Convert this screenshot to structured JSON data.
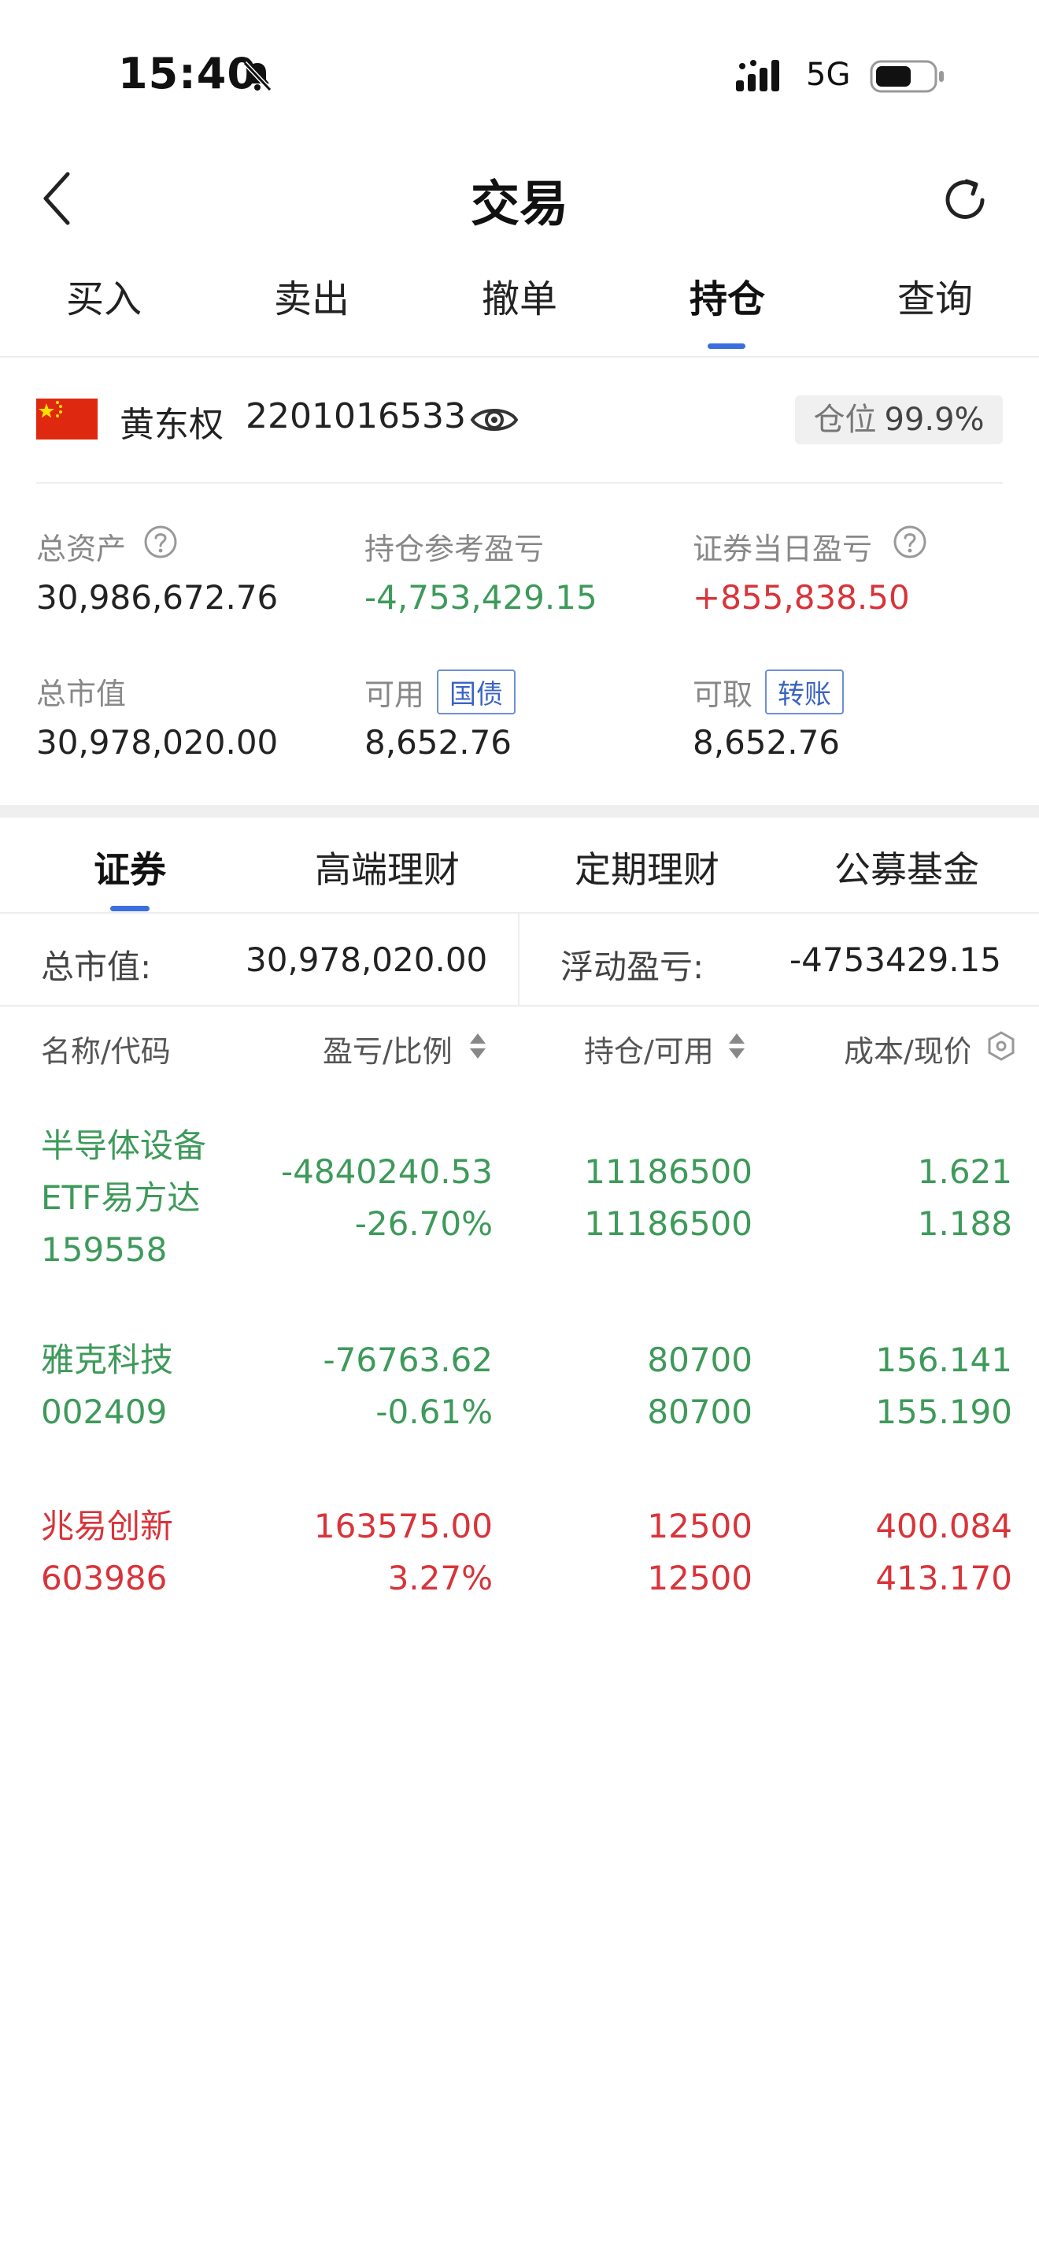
{
  "status_bar": {
    "time": "15:40",
    "network": "5G"
  },
  "nav": {
    "title": "交易"
  },
  "tabs": [
    "买入",
    "卖出",
    "撤单",
    "持仓",
    "查询"
  ],
  "account": {
    "name": "黄东权",
    "id": "2201016533",
    "position_label": "仓位",
    "position_value": "99.9%"
  },
  "metrics": {
    "total_assets_label": "总资产",
    "total_assets": "30,986,672.76",
    "holding_pnl_label": "持仓参考盈亏",
    "holding_pnl": "-4,753,429.15",
    "daily_pnl_label": "证券当日盈亏",
    "daily_pnl": "+855,838.50",
    "market_value_label": "总市值",
    "market_value": "30,978,020.00",
    "available_label": "可用",
    "available_tag": "国债",
    "available": "8,652.76",
    "withdrawable_label": "可取",
    "withdrawable_tag": "转账",
    "withdrawable": "8,652.76"
  },
  "subtabs": [
    "证券",
    "高端理财",
    "定期理财",
    "公募基金"
  ],
  "summary": {
    "market_value_label": "总市值:",
    "market_value": "30,978,020.00",
    "float_pnl_label": "浮动盈亏:",
    "float_pnl": "-4753429.15"
  },
  "table": {
    "headers": [
      "名称/代码",
      "盈亏/比例",
      "持仓/可用",
      "成本/现价"
    ],
    "rows": [
      {
        "name1": "半导体设备",
        "name2": "ETF易方达",
        "code": "159558",
        "pnl": "-4840240.53",
        "ratio": "-26.70%",
        "holding": "11186500",
        "available": "11186500",
        "cost": "1.621",
        "price": "1.188",
        "color": "#3e9a5a"
      },
      {
        "name1": "雅克科技",
        "code": "002409",
        "pnl": "-76763.62",
        "ratio": "-0.61%",
        "holding": "80700",
        "available": "80700",
        "cost": "156.141",
        "price": "155.190",
        "color": "#3e9a5a"
      },
      {
        "name1": "兆易创新",
        "code": "603986",
        "pnl": "163575.00",
        "ratio": "3.27%",
        "holding": "12500",
        "available": "12500",
        "cost": "400.084",
        "price": "413.170",
        "color": "#d8343a"
      }
    ]
  },
  "icons": {
    "back": "chevron-left-icon",
    "refresh": "refresh-icon",
    "eye": "eye-icon",
    "help": "question-circle-icon",
    "settings": "settings-hex-icon",
    "flag": "china-flag-icon"
  }
}
